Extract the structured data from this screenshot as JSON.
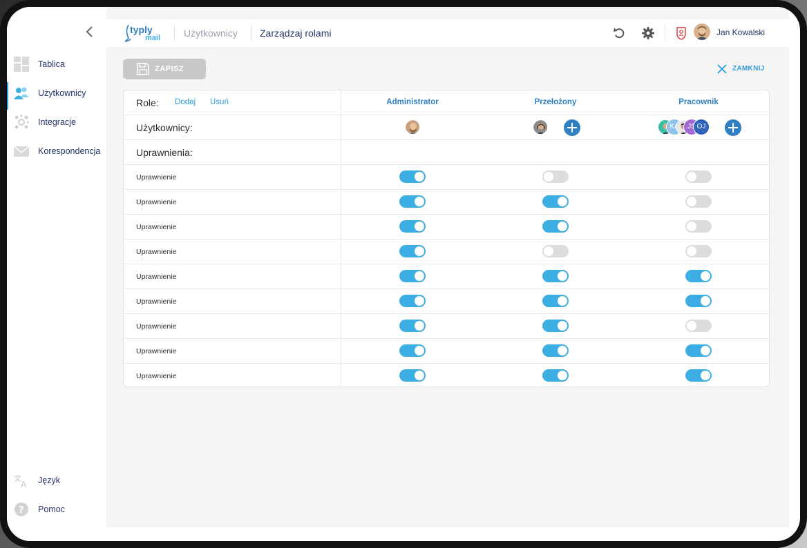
{
  "sidebar": {
    "items": [
      {
        "label": "Tablica",
        "icon": "dashboard-icon"
      },
      {
        "label": "Użytkownicy",
        "icon": "users-icon"
      },
      {
        "label": "Integracje",
        "icon": "integrations-icon"
      },
      {
        "label": "Korespondencja",
        "icon": "mail-icon"
      }
    ],
    "bottom": [
      {
        "label": "Język",
        "icon": "translate-icon"
      },
      {
        "label": "Pomoc",
        "icon": "help-icon"
      }
    ]
  },
  "header": {
    "logo_top": "typly",
    "logo_bottom": "mail",
    "breadcrumb": [
      "Użytkownicy",
      "Zarządzaj rolami"
    ],
    "user_name": "Jan Kowalski"
  },
  "toolbar": {
    "save_label": "ZAPISZ",
    "close_label": "ZAMKNIJ"
  },
  "table": {
    "roles_label": "Role:",
    "add_link": "Dodaj",
    "remove_link": "Usuń",
    "users_label": "Użytkownicy:",
    "permissions_label": "Uprawnienia:",
    "roles": [
      "Administrator",
      "Przełożony",
      "Pracownik"
    ],
    "role_user_initials": [
      "KA",
      "JS",
      "OJ"
    ],
    "permissions": [
      {
        "label": "Uprawnienie",
        "values": [
          true,
          false,
          false
        ]
      },
      {
        "label": "Uprawnienie",
        "values": [
          true,
          true,
          false
        ]
      },
      {
        "label": "Uprawnienie",
        "values": [
          true,
          true,
          false
        ]
      },
      {
        "label": "Uprawnienie",
        "values": [
          true,
          false,
          false
        ]
      },
      {
        "label": "Uprawnienie",
        "values": [
          true,
          true,
          true
        ]
      },
      {
        "label": "Uprawnienie",
        "values": [
          true,
          true,
          true
        ]
      },
      {
        "label": "Uprawnienie",
        "values": [
          true,
          true,
          false
        ]
      },
      {
        "label": "Uprawnienie",
        "values": [
          true,
          true,
          true
        ]
      },
      {
        "label": "Uprawnienie",
        "values": [
          true,
          true,
          true
        ]
      }
    ]
  },
  "colors": {
    "accent": "#3daee3",
    "primary": "#2f7fc2",
    "toggle_off": "#dcdcdc"
  }
}
